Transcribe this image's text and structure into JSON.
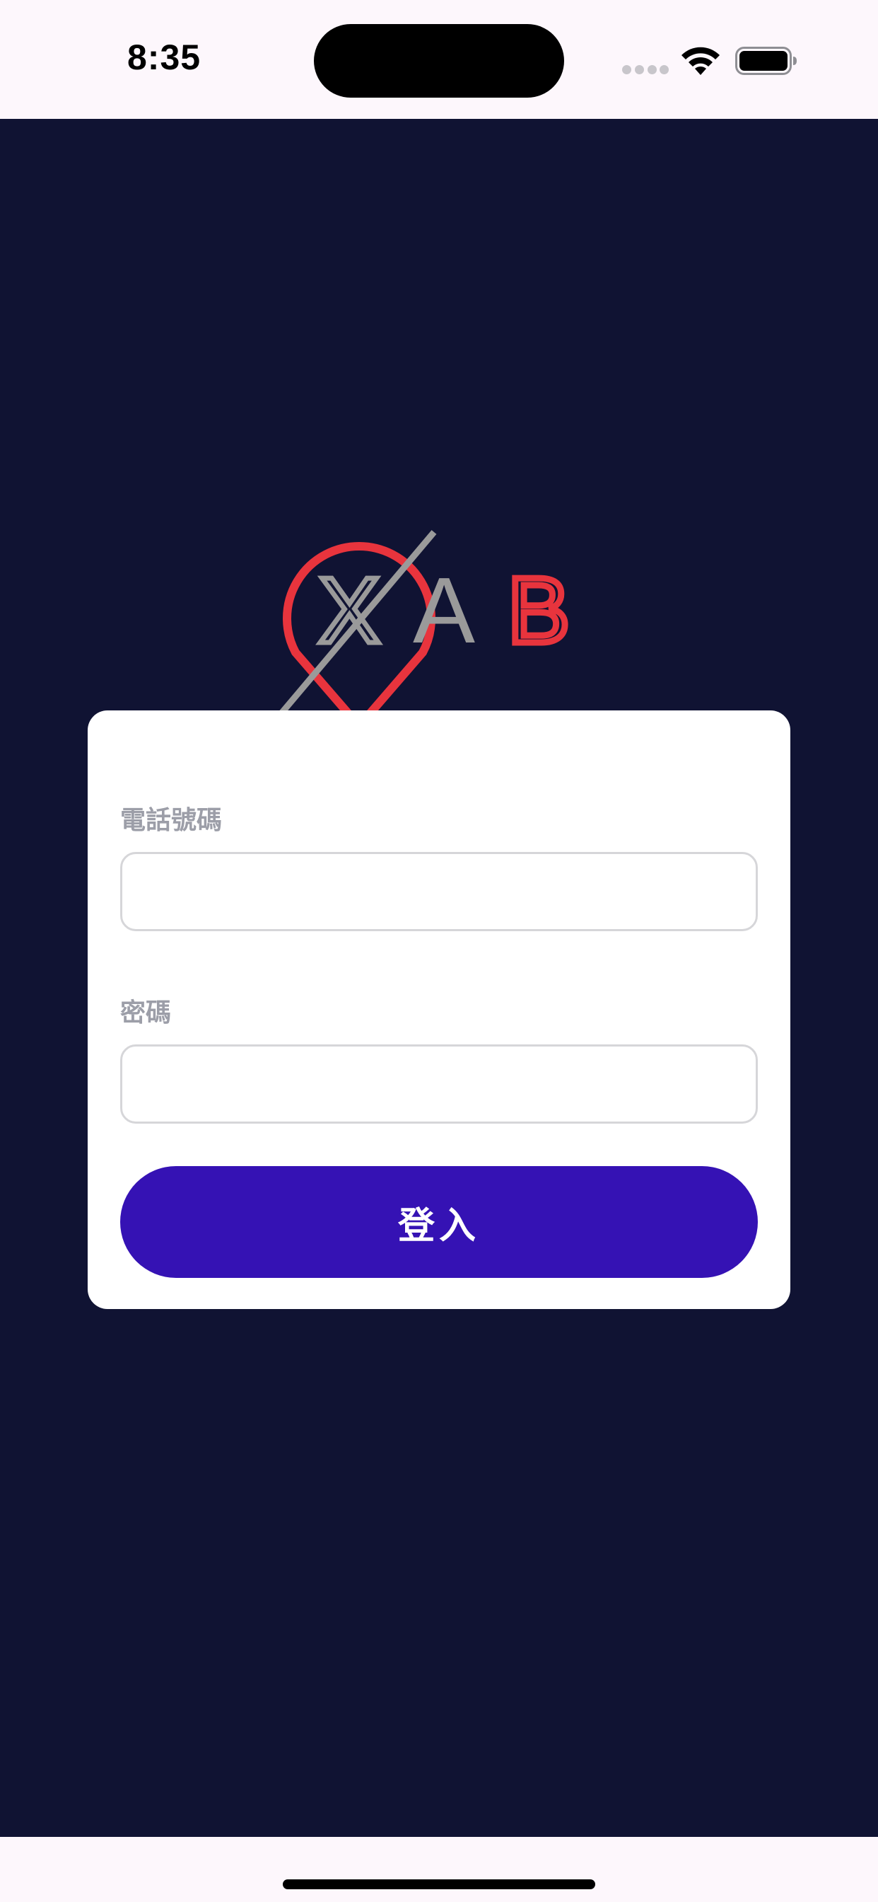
{
  "status_bar": {
    "time": "8:35",
    "icons": [
      "cellular-signal-icon",
      "wifi-icon",
      "battery-icon"
    ]
  },
  "logo": {
    "text_x": "X",
    "text_a": "A",
    "text_b": "B",
    "icon": "map-pin-icon"
  },
  "login_form": {
    "phone_label": "電話號碼",
    "phone_value": "",
    "phone_placeholder": "",
    "password_label": "密碼",
    "password_value": "",
    "password_placeholder": "",
    "submit_label": "登入"
  },
  "colors": {
    "background": "#101333",
    "status_bar": "#fdf7fc",
    "card": "#ffffff",
    "label": "#9c9ea8",
    "input_border": "#d6d6d9",
    "button": "#3512b4",
    "logo_red": "#e8343d",
    "logo_gray": "#9a9a9a"
  }
}
